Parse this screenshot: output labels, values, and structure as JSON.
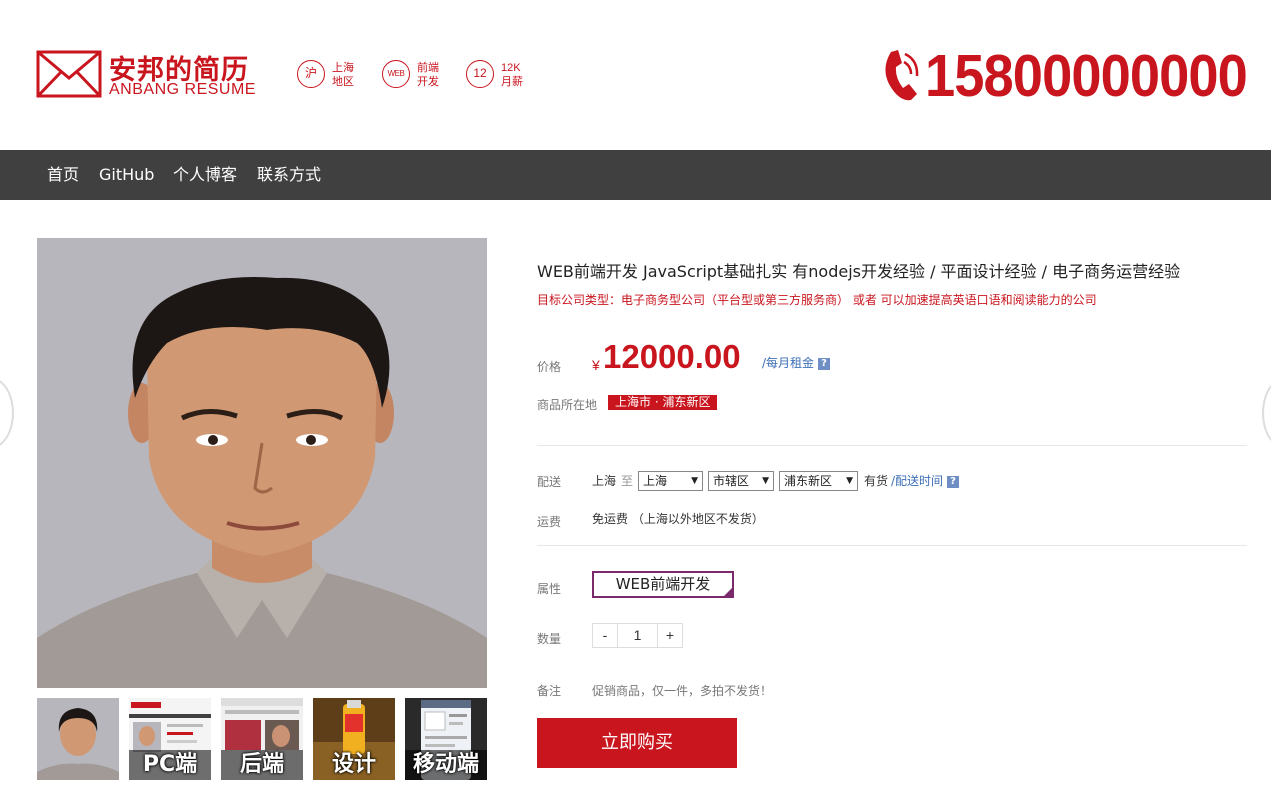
{
  "header": {
    "logo_title": "安邦的简历",
    "logo_subtitle": "ANBANG RESUME",
    "badges": [
      {
        "icon": "沪",
        "line1": "上海",
        "line2": "地区"
      },
      {
        "icon": "WEB",
        "line1": "前端",
        "line2": "开发"
      },
      {
        "icon": "12",
        "line1": "12K",
        "line2": "月薪"
      }
    ],
    "phone": "15800000000"
  },
  "nav": {
    "items": [
      "首页",
      "GitHub",
      "个人博客",
      "联系方式"
    ]
  },
  "gallery": {
    "thumbs": [
      "",
      "PC端",
      "后端",
      "设计",
      "移动端"
    ]
  },
  "product": {
    "title": "WEB前端开发 JavaScript基础扎实 有nodejs开发经验 / 平面设计经验 / 电子商务运营经验",
    "subtitle": "目标公司类型：电子商务型公司（平台型或第三方服务商） 或者 可以加速提高英语口语和阅读能力的公司",
    "price_label": "价格",
    "currency": "¥",
    "price": "12000.00",
    "price_unit": "/每月租金",
    "location_label": "商品所在地",
    "location": "上海市 · 浦东新区",
    "delivery_label": "配送",
    "ship_from": "上海",
    "ship_to": "至",
    "selects": [
      "上海",
      "市辖区",
      "浦东新区"
    ],
    "stock": "有货",
    "delivery_time": "/配送时间",
    "freight_label": "运费",
    "freight": "免运费 （上海以外地区不发货）",
    "attr_label": "属性",
    "attr_value": "WEB前端开发",
    "qty_label": "数量",
    "qty_minus": "-",
    "qty_value": "1",
    "qty_plus": "+",
    "note_label": "备注",
    "note": "促销商品，仅一件，多拍不发货！",
    "buy_label": "立即购买"
  },
  "colors": {
    "brand": "#c9151e",
    "nav_bg": "#404040",
    "link": "#3d6fb6"
  }
}
